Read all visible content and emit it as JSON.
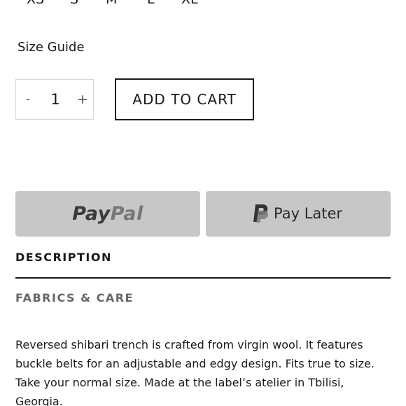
{
  "sizes": [
    "XS",
    "S",
    "M",
    "L",
    "XL"
  ],
  "size_guide_label": "Size Guide",
  "quantity": {
    "minus_label": "-",
    "value": "1",
    "plus_label": "+"
  },
  "add_to_cart_label": "ADD TO CART",
  "payment": {
    "paypal_pay": "Pay",
    "paypal_pal": "Pal",
    "paylater_label": "Pay Later",
    "button_color": "#c7c7c7"
  },
  "tabs": {
    "description": "DESCRIPTION",
    "fabrics_care": "FABRICS & CARE"
  },
  "description_text": "Reversed shibari trench is crafted from virgin wool. It features buckle belts for an adjustable and edgy design. Fits true to size. Take your normal size. Made at the label’s atelier in Tbilisi, Georgia."
}
